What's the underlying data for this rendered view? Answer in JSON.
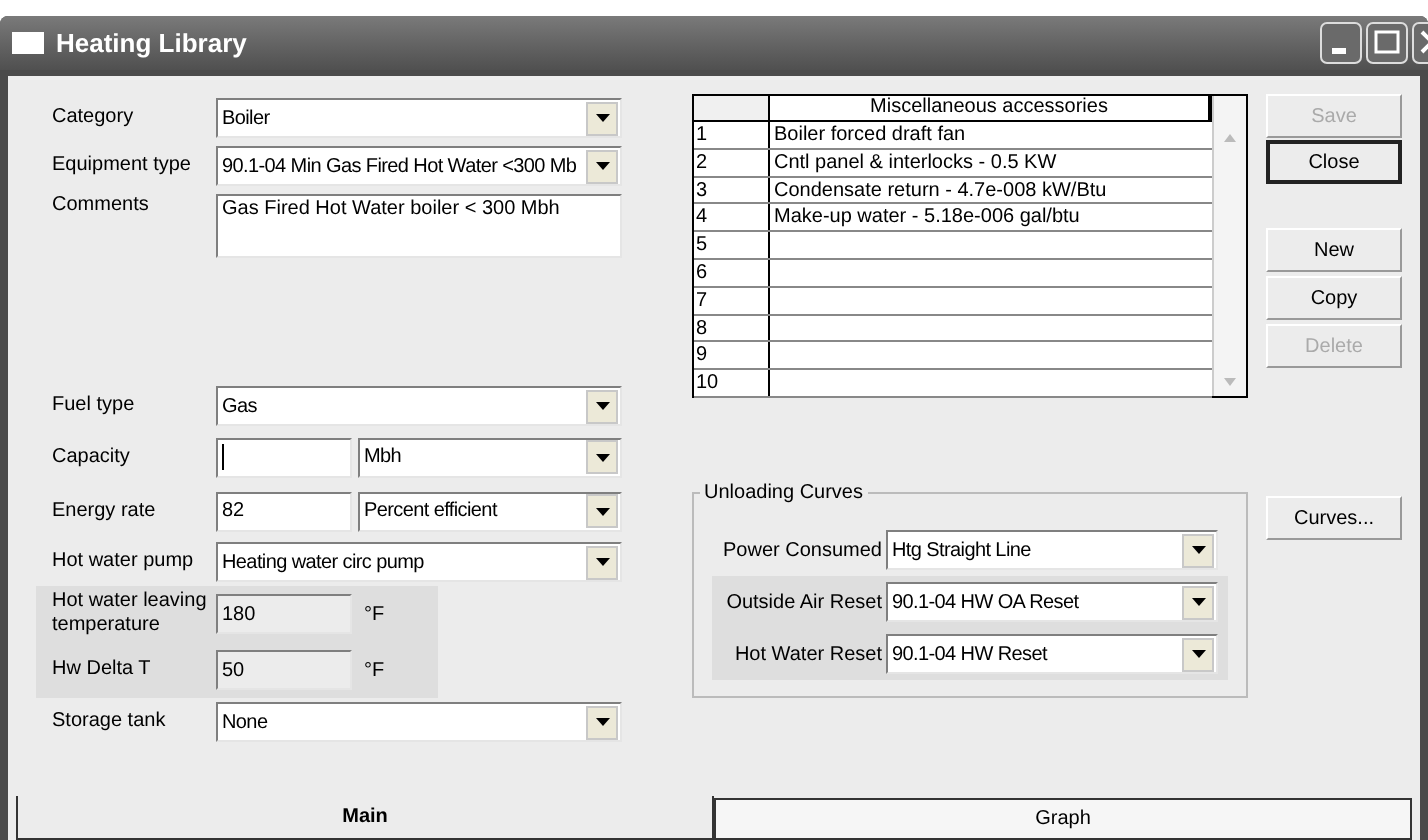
{
  "window": {
    "title": "Heating Library"
  },
  "form": [
    {
      "kind": "dropdown",
      "label": "Category",
      "value": "Boiler"
    },
    {
      "kind": "dropdown",
      "label": "Equipment type",
      "value": "90.1-04 Min Gas Fired Hot Water <300 Mb"
    },
    {
      "kind": "memo",
      "label": "Comments",
      "value": "Gas Fired Hot Water boiler < 300 Mbh"
    },
    {
      "kind": "dropdown",
      "label": "Fuel type",
      "value": "Gas"
    },
    {
      "kind": "pair",
      "label": "Capacity",
      "unit": "Mbh",
      "focused": true
    },
    {
      "kind": "pair",
      "label": "Energy rate",
      "value": "82",
      "unit": "Percent efficient",
      "focused": false
    },
    {
      "kind": "dropdown",
      "label": "Hot water pump",
      "value": "Heating water circ pump"
    },
    {
      "kind": "readonly",
      "label": "Hot water leaving temperature",
      "value": "180",
      "unit": "°F"
    },
    {
      "kind": "readonly",
      "label": "Hw Delta T",
      "value": "50",
      "unit": "°F"
    },
    {
      "kind": "dropdown",
      "label": "Storage tank",
      "value": "None"
    }
  ],
  "table": {
    "header": "Miscellaneous accessories",
    "rows": [
      {
        "number": "1",
        "text": "Boiler forced draft fan"
      },
      {
        "number": "2",
        "text": "Cntl panel & interlocks - 0.5 KW"
      },
      {
        "number": "3",
        "text": "Condensate return - 4.7e-008 kW/Btu"
      },
      {
        "number": "4",
        "text": "Make-up water - 5.18e-006 gal/btu"
      },
      {
        "number": "5"
      },
      {
        "number": "6"
      },
      {
        "number": "7"
      },
      {
        "number": "8"
      },
      {
        "number": "9"
      },
      {
        "number": "10"
      }
    ]
  },
  "buttons": [
    {
      "label": "Save",
      "disabled": true,
      "default": false
    },
    {
      "label": "Close",
      "disabled": false,
      "default": true
    },
    {
      "label": "New",
      "disabled": false,
      "default": false
    },
    {
      "label": "Copy",
      "disabled": false,
      "default": false
    },
    {
      "label": "Delete",
      "disabled": true,
      "default": false
    }
  ],
  "unloading_curves": {
    "title": "Unloading Curves",
    "rows": [
      {
        "label": "Power Consumed",
        "value": "Htg Straight Line",
        "shaded": false
      },
      {
        "label": "Outside Air Reset",
        "value": "90.1-04 HW OA Reset",
        "shaded": true
      },
      {
        "label": "Hot Water Reset",
        "value": "90.1-04 HW Reset",
        "shaded": true
      }
    ]
  },
  "curves_button": {
    "label": "Curves...",
    "disabled": false
  },
  "tabs": [
    {
      "label": "Main",
      "selected": true
    },
    {
      "label": "Graph",
      "selected": false
    }
  ]
}
